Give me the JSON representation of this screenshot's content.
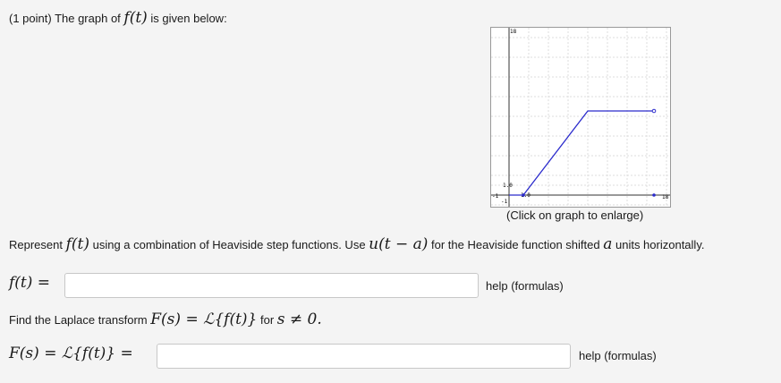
{
  "header": {
    "prefix": "(1 point) The graph of ",
    "ft": "f(t)",
    "suffix": " is given below:"
  },
  "graph": {
    "caption": "(Click on graph to enlarge)",
    "axis_labels": {
      "y_top": "18",
      "y_one": "1.0",
      "x_one": "1.0",
      "x_right": "18",
      "x_left": "-1",
      "y_bottom": "-1"
    },
    "line_color": "#2b2bcc"
  },
  "represent": {
    "t1": "Represent ",
    "m1": "f(t)",
    "t2": " using a combination of Heaviside step functions. Use ",
    "m2": "u(t − a)",
    "t3": " for the Heaviside function shifted ",
    "m3": "a",
    "t4": " units horizontally."
  },
  "answer1": {
    "label": "f(t) =",
    "value": "",
    "help": "help (formulas)"
  },
  "laplace": {
    "t1": "Find the Laplace transform ",
    "m1": "F(s) = ℒ{f(t)}",
    "t2": " for ",
    "m2": "s ≠ 0."
  },
  "answer2": {
    "label": "F(s) = ℒ{f(t)} =",
    "value": "",
    "help": "help (formulas)"
  }
}
